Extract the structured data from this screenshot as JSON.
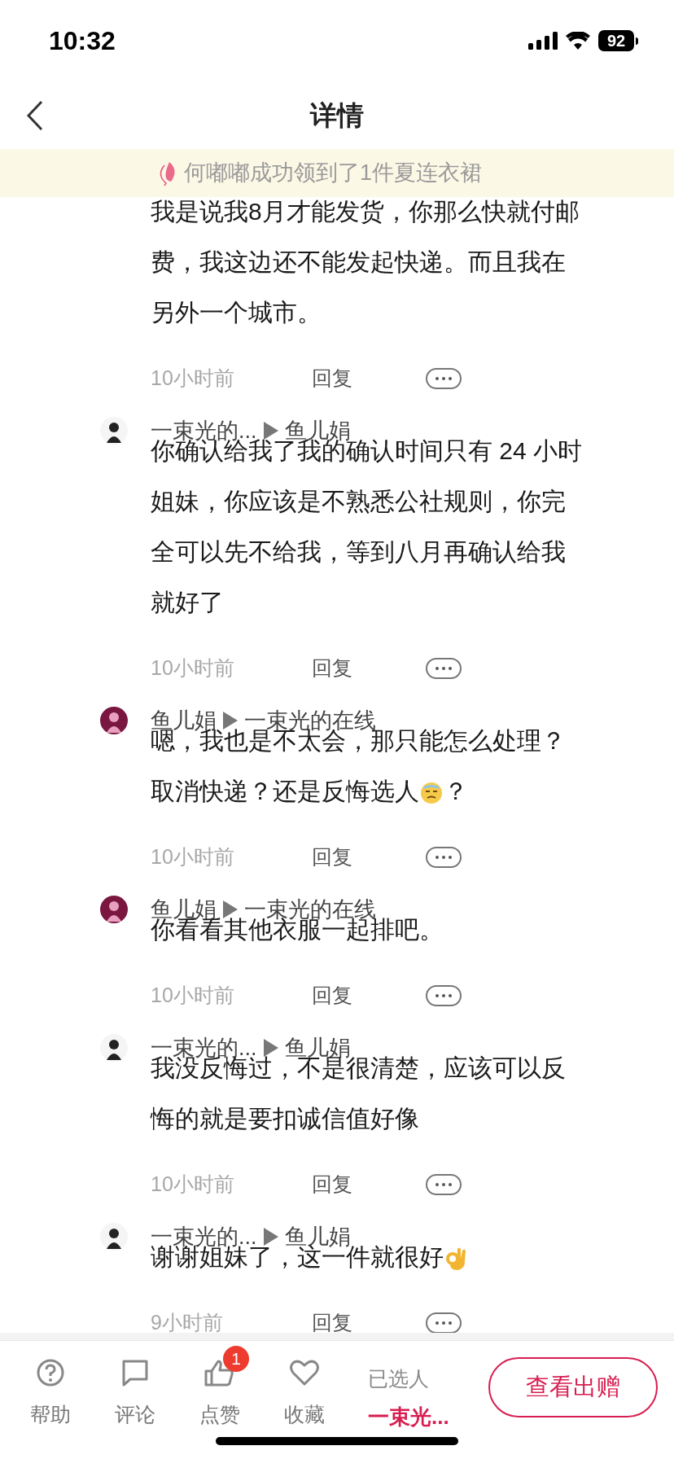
{
  "status_bar": {
    "time": "10:32",
    "battery": "92"
  },
  "nav": {
    "title": "详情"
  },
  "banner": {
    "text": "何嘟嘟成功领到了1件夏连衣裙"
  },
  "comments": [
    {
      "body": [
        {
          "kind": "text",
          "text": "我是说我8月才能发货，你那么快就付邮费，我这边还不能发起快递。而且我在另外一个城市。"
        }
      ],
      "time": "10小时前",
      "reply": "回复"
    },
    {
      "author": "一束光的...",
      "reply_to": "鱼儿娟",
      "color": "#f5f5f5",
      "body": [
        {
          "kind": "text",
          "text": "你确认给我了我的确认时间只有 24 小时姐妹，你应该是不熟悉公社规则，你完全可以先不给我，等到八月再确认给我就好了"
        }
      ],
      "time": "10小时前",
      "reply": "回复"
    },
    {
      "author": "鱼儿娟",
      "reply_to": "一束光的在线",
      "color": "#7a1740",
      "body": [
        {
          "kind": "text",
          "text": "嗯，我也是不太会，那只能怎么处理？"
        },
        {
          "kind": "text",
          "text": "取消快递？还是反悔选人"
        },
        {
          "kind": "sweat-emoji"
        },
        {
          "kind": "text",
          "text": "？"
        }
      ],
      "time": "10小时前",
      "reply": "回复"
    },
    {
      "author": "鱼儿娟",
      "reply_to": "一束光的在线",
      "color": "#7a1740",
      "body": [
        {
          "kind": "text",
          "text": "你看看其他衣服一起排吧。"
        }
      ],
      "time": "10小时前",
      "reply": "回复"
    },
    {
      "author": "一束光的...",
      "reply_to": "鱼儿娟",
      "color": "#f5f5f5",
      "body": [
        {
          "kind": "text",
          "text": "我没反悔过，不是很清楚，应该可以反悔的就是要扣诚信值好像"
        }
      ],
      "time": "10小时前",
      "reply": "回复"
    },
    {
      "author": "一束光的...",
      "reply_to": "鱼儿娟",
      "color": "#f5f5f5",
      "body": [
        {
          "kind": "text",
          "text": "谢谢姐妹了，这一件就很好"
        },
        {
          "kind": "ok-emoji"
        }
      ],
      "time": "9小时前",
      "reply": "回复"
    }
  ],
  "bottom_bar": {
    "actions": [
      {
        "kind": "help",
        "label": "帮助"
      },
      {
        "kind": "comment",
        "label": "评论"
      },
      {
        "kind": "like",
        "label": "点赞",
        "badge": "1"
      },
      {
        "kind": "favorite",
        "label": "收藏"
      }
    ],
    "selected_label": "已选人",
    "selected_name": "一束光...",
    "button": "查看出赠"
  }
}
